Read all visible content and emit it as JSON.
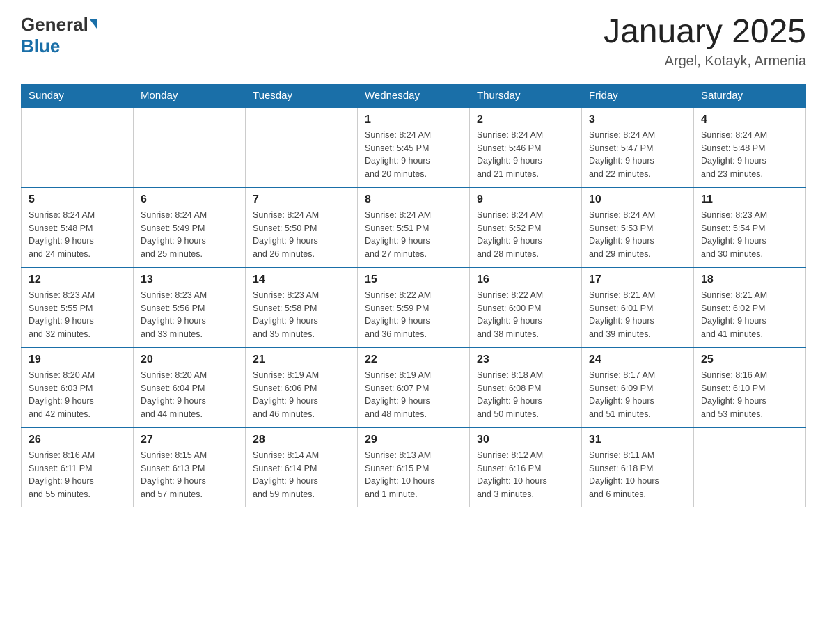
{
  "header": {
    "logo_general": "General",
    "logo_blue": "Blue",
    "title": "January 2025",
    "subtitle": "Argel, Kotayk, Armenia"
  },
  "days_of_week": [
    "Sunday",
    "Monday",
    "Tuesday",
    "Wednesday",
    "Thursday",
    "Friday",
    "Saturday"
  ],
  "weeks": [
    [
      {
        "day": "",
        "info": ""
      },
      {
        "day": "",
        "info": ""
      },
      {
        "day": "",
        "info": ""
      },
      {
        "day": "1",
        "info": "Sunrise: 8:24 AM\nSunset: 5:45 PM\nDaylight: 9 hours\nand 20 minutes."
      },
      {
        "day": "2",
        "info": "Sunrise: 8:24 AM\nSunset: 5:46 PM\nDaylight: 9 hours\nand 21 minutes."
      },
      {
        "day": "3",
        "info": "Sunrise: 8:24 AM\nSunset: 5:47 PM\nDaylight: 9 hours\nand 22 minutes."
      },
      {
        "day": "4",
        "info": "Sunrise: 8:24 AM\nSunset: 5:48 PM\nDaylight: 9 hours\nand 23 minutes."
      }
    ],
    [
      {
        "day": "5",
        "info": "Sunrise: 8:24 AM\nSunset: 5:48 PM\nDaylight: 9 hours\nand 24 minutes."
      },
      {
        "day": "6",
        "info": "Sunrise: 8:24 AM\nSunset: 5:49 PM\nDaylight: 9 hours\nand 25 minutes."
      },
      {
        "day": "7",
        "info": "Sunrise: 8:24 AM\nSunset: 5:50 PM\nDaylight: 9 hours\nand 26 minutes."
      },
      {
        "day": "8",
        "info": "Sunrise: 8:24 AM\nSunset: 5:51 PM\nDaylight: 9 hours\nand 27 minutes."
      },
      {
        "day": "9",
        "info": "Sunrise: 8:24 AM\nSunset: 5:52 PM\nDaylight: 9 hours\nand 28 minutes."
      },
      {
        "day": "10",
        "info": "Sunrise: 8:24 AM\nSunset: 5:53 PM\nDaylight: 9 hours\nand 29 minutes."
      },
      {
        "day": "11",
        "info": "Sunrise: 8:23 AM\nSunset: 5:54 PM\nDaylight: 9 hours\nand 30 minutes."
      }
    ],
    [
      {
        "day": "12",
        "info": "Sunrise: 8:23 AM\nSunset: 5:55 PM\nDaylight: 9 hours\nand 32 minutes."
      },
      {
        "day": "13",
        "info": "Sunrise: 8:23 AM\nSunset: 5:56 PM\nDaylight: 9 hours\nand 33 minutes."
      },
      {
        "day": "14",
        "info": "Sunrise: 8:23 AM\nSunset: 5:58 PM\nDaylight: 9 hours\nand 35 minutes."
      },
      {
        "day": "15",
        "info": "Sunrise: 8:22 AM\nSunset: 5:59 PM\nDaylight: 9 hours\nand 36 minutes."
      },
      {
        "day": "16",
        "info": "Sunrise: 8:22 AM\nSunset: 6:00 PM\nDaylight: 9 hours\nand 38 minutes."
      },
      {
        "day": "17",
        "info": "Sunrise: 8:21 AM\nSunset: 6:01 PM\nDaylight: 9 hours\nand 39 minutes."
      },
      {
        "day": "18",
        "info": "Sunrise: 8:21 AM\nSunset: 6:02 PM\nDaylight: 9 hours\nand 41 minutes."
      }
    ],
    [
      {
        "day": "19",
        "info": "Sunrise: 8:20 AM\nSunset: 6:03 PM\nDaylight: 9 hours\nand 42 minutes."
      },
      {
        "day": "20",
        "info": "Sunrise: 8:20 AM\nSunset: 6:04 PM\nDaylight: 9 hours\nand 44 minutes."
      },
      {
        "day": "21",
        "info": "Sunrise: 8:19 AM\nSunset: 6:06 PM\nDaylight: 9 hours\nand 46 minutes."
      },
      {
        "day": "22",
        "info": "Sunrise: 8:19 AM\nSunset: 6:07 PM\nDaylight: 9 hours\nand 48 minutes."
      },
      {
        "day": "23",
        "info": "Sunrise: 8:18 AM\nSunset: 6:08 PM\nDaylight: 9 hours\nand 50 minutes."
      },
      {
        "day": "24",
        "info": "Sunrise: 8:17 AM\nSunset: 6:09 PM\nDaylight: 9 hours\nand 51 minutes."
      },
      {
        "day": "25",
        "info": "Sunrise: 8:16 AM\nSunset: 6:10 PM\nDaylight: 9 hours\nand 53 minutes."
      }
    ],
    [
      {
        "day": "26",
        "info": "Sunrise: 8:16 AM\nSunset: 6:11 PM\nDaylight: 9 hours\nand 55 minutes."
      },
      {
        "day": "27",
        "info": "Sunrise: 8:15 AM\nSunset: 6:13 PM\nDaylight: 9 hours\nand 57 minutes."
      },
      {
        "day": "28",
        "info": "Sunrise: 8:14 AM\nSunset: 6:14 PM\nDaylight: 9 hours\nand 59 minutes."
      },
      {
        "day": "29",
        "info": "Sunrise: 8:13 AM\nSunset: 6:15 PM\nDaylight: 10 hours\nand 1 minute."
      },
      {
        "day": "30",
        "info": "Sunrise: 8:12 AM\nSunset: 6:16 PM\nDaylight: 10 hours\nand 3 minutes."
      },
      {
        "day": "31",
        "info": "Sunrise: 8:11 AM\nSunset: 6:18 PM\nDaylight: 10 hours\nand 6 minutes."
      },
      {
        "day": "",
        "info": ""
      }
    ]
  ]
}
